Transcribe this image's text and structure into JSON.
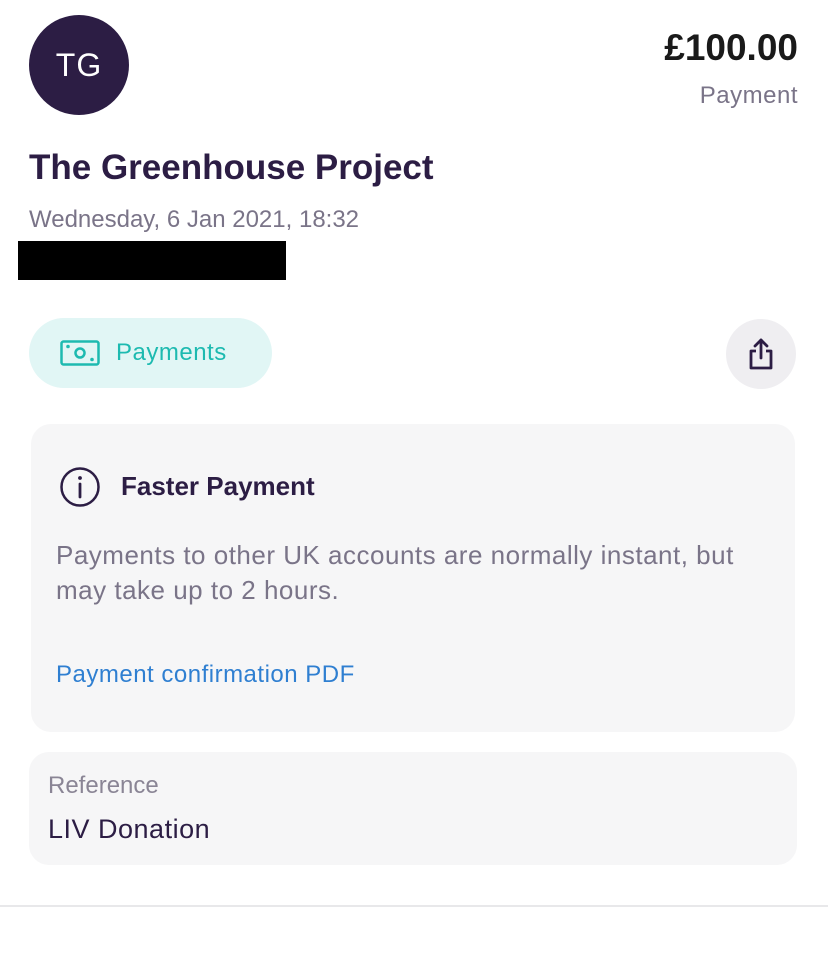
{
  "header": {
    "avatar_initials": "TG",
    "amount": "£100.00",
    "amount_type": "Payment"
  },
  "transaction": {
    "merchant_name": "The Greenhouse Project",
    "datetime": "Wednesday, 6 Jan 2021, 18:32"
  },
  "category": {
    "label": "Payments",
    "icon": "banknote-icon",
    "color": "#1dbab0"
  },
  "share": {
    "icon": "share-icon"
  },
  "info_card": {
    "icon": "info-icon",
    "title": "Faster Payment",
    "body": "Payments to other UK accounts are normally instant, but may take up to 2 hours.",
    "link_label": "Payment confirmation PDF"
  },
  "reference": {
    "label": "Reference",
    "value": "LIV Donation"
  },
  "colors": {
    "brand_dark": "#2c1d44",
    "accent_teal": "#1dbab0",
    "link_blue": "#2f7fd1",
    "muted_text": "#7a7488"
  }
}
